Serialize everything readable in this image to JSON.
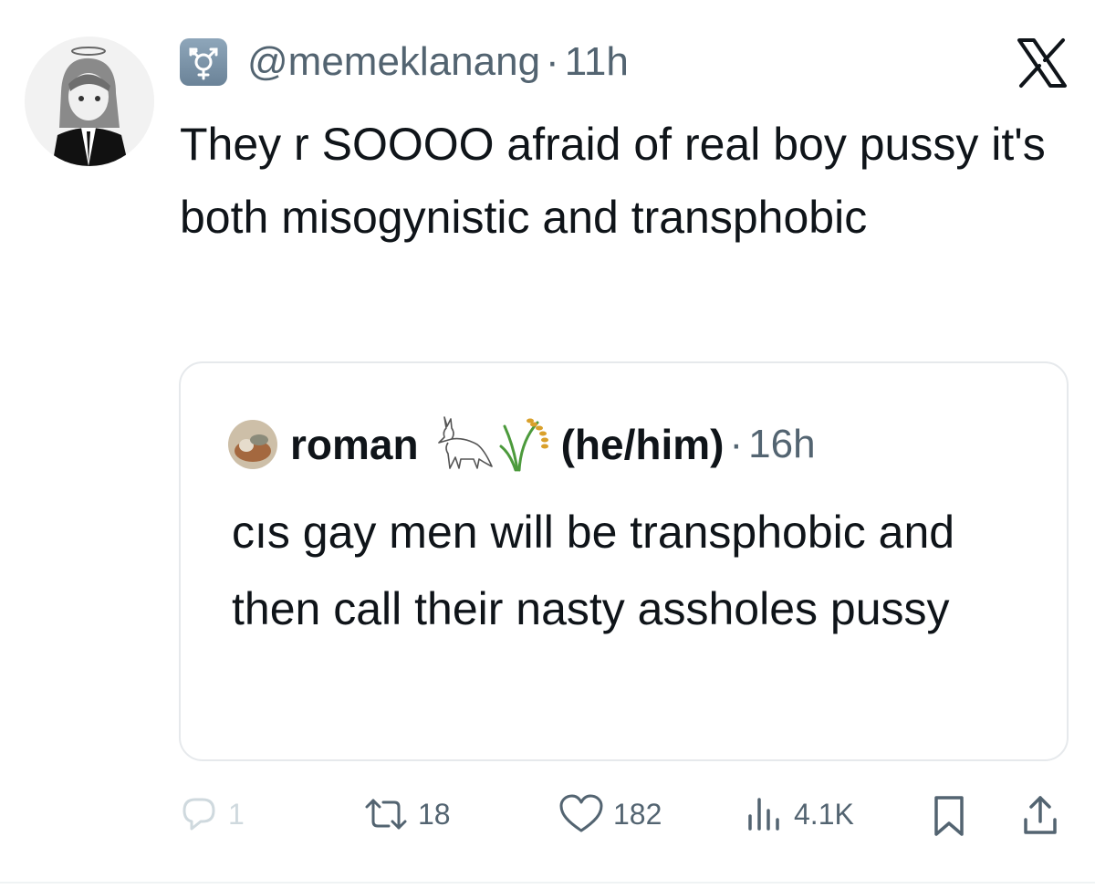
{
  "tweet": {
    "handle": "@memeklanang",
    "separator": "·",
    "time": "11h",
    "text": "They r SOOOO afraid of real boy pussy it's both misogynistic and transphobic",
    "flag_emoji_icon": "transgender-symbol-icon"
  },
  "quote": {
    "name": "roman",
    "emojis": [
      "fox-outline-icon",
      "rice-sheaf-icon"
    ],
    "pronouns": "(he/him)",
    "separator": "·",
    "time": "16h",
    "text": "cıs gay men will be transphobic and then call their nasty assholes pussy"
  },
  "actions": {
    "reply_count": "1",
    "retweet_count": "18",
    "like_count": "182",
    "views_count": "4.1K"
  },
  "colors": {
    "text": "#0f1419",
    "muted": "#536471",
    "border": "#e6e9ec"
  }
}
